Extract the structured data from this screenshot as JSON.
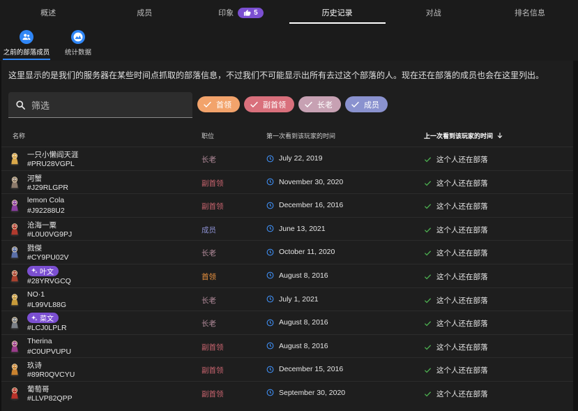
{
  "tabs": [
    {
      "label": "概述"
    },
    {
      "label": "成员"
    },
    {
      "label": "印象",
      "badge": "5"
    },
    {
      "label": "历史记录"
    },
    {
      "label": "对战"
    },
    {
      "label": "排名信息"
    }
  ],
  "subtabs": [
    {
      "label": "之前的部落成员"
    },
    {
      "label": "统计数据"
    }
  ],
  "description": "这里显示的是我们的服务器在某些时间点抓取的部落信息，不过我们不可能显示出所有去过这个部落的人。现在还在部落的成员也会在这里列出。",
  "search": {
    "placeholder": "筛选"
  },
  "filters": [
    {
      "label": "首领",
      "color": "#f2a36b"
    },
    {
      "label": "副首领",
      "color": "#d9707c"
    },
    {
      "label": "长老",
      "color": "#c7a1b3"
    },
    {
      "label": "成员",
      "color": "#8a92cf"
    }
  ],
  "columns": {
    "name": "名称",
    "role": "职位",
    "first_seen": "第一次看到该玩家的时间",
    "last_seen": "上一次看到该玩家的时间"
  },
  "role_colors": {
    "长老": "#b68e9e",
    "副首领": "#c9646f",
    "首领": "#e8913f",
    "成员": "#8b8fd0"
  },
  "members": [
    {
      "name": "一只小懒阎天涯",
      "tag": "#PRU28VGPL",
      "role": "长老",
      "first_seen": "July 22, 2019",
      "last_seen": "这个人还在部落",
      "legend": false
    },
    {
      "name": "河蟹",
      "tag": "#J29RLGPR",
      "role": "副首领",
      "first_seen": "November 30, 2020",
      "last_seen": "这个人还在部落",
      "legend": false
    },
    {
      "name": "lemon Cola",
      "tag": "#J92288U2",
      "role": "副首领",
      "first_seen": "December 16, 2016",
      "last_seen": "这个人还在部落",
      "legend": false
    },
    {
      "name": "沧海一粟",
      "tag": "#L0U0VG9PJ",
      "role": "成员",
      "first_seen": "June 13, 2021",
      "last_seen": "这个人还在部落",
      "legend": false
    },
    {
      "name": "戮傑",
      "tag": "#CY9PU02V",
      "role": "长老",
      "first_seen": "October 11, 2020",
      "last_seen": "这个人还在部落",
      "legend": false
    },
    {
      "name": "叶文",
      "tag": "#28YRVGCQ",
      "role": "首领",
      "first_seen": "August 8, 2016",
      "last_seen": "这个人还在部落",
      "legend": true
    },
    {
      "name": "NO·1",
      "tag": "#L99VL88G",
      "role": "长老",
      "first_seen": "July 1, 2021",
      "last_seen": "这个人还在部落",
      "legend": false
    },
    {
      "name": "菜文",
      "tag": "#LCJ0LPLR",
      "role": "长老",
      "first_seen": "August 8, 2016",
      "last_seen": "这个人还在部落",
      "legend": true
    },
    {
      "name": "Therina",
      "tag": "#C0UPVUPU",
      "role": "副首领",
      "first_seen": "August 8, 2016",
      "last_seen": "这个人还在部落",
      "legend": false
    },
    {
      "name": "玖诗",
      "tag": "#89R0QVCYU",
      "role": "副首领",
      "first_seen": "December 15, 2016",
      "last_seen": "这个人还在部落",
      "legend": false
    },
    {
      "name": "葡萄哥",
      "tag": "#LLVP82QPP",
      "role": "副首领",
      "first_seen": "September 30, 2020",
      "last_seen": "这个人还在部落",
      "legend": false
    }
  ]
}
